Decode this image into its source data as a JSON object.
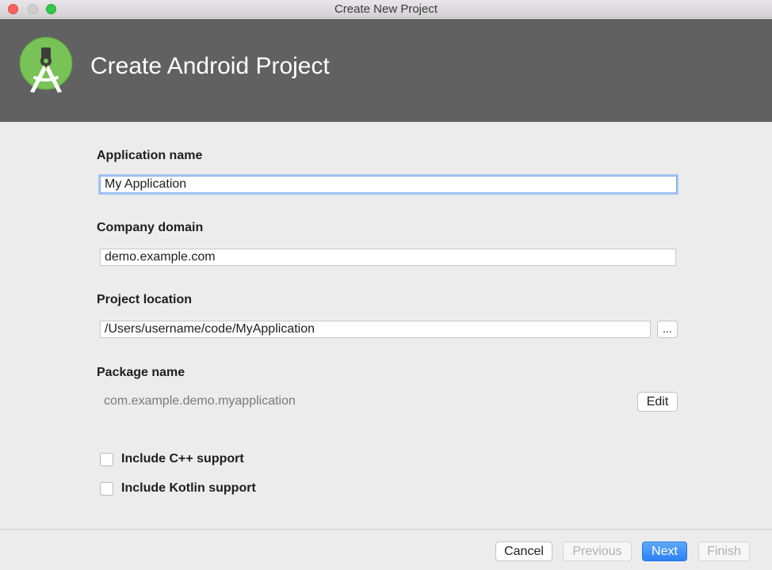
{
  "window": {
    "title": "Create New Project"
  },
  "header": {
    "title": "Create Android Project",
    "logo_icon": "android-studio-icon"
  },
  "form": {
    "application_name": {
      "label": "Application name",
      "value": "My Application"
    },
    "company_domain": {
      "label": "Company domain",
      "value": "demo.example.com"
    },
    "project_location": {
      "label": "Project location",
      "value": "/Users/username/code/MyApplication",
      "browse_label": "..."
    },
    "package_name": {
      "label": "Package name",
      "value": "com.example.demo.myapplication",
      "edit_label": "Edit"
    },
    "include_cpp": {
      "label": "Include C++ support",
      "checked": false
    },
    "include_kotlin": {
      "label": "Include Kotlin support",
      "checked": false
    }
  },
  "footer": {
    "cancel_label": "Cancel",
    "previous_label": "Previous",
    "next_label": "Next",
    "finish_label": "Finish"
  },
  "colors": {
    "header_bg": "#616161",
    "primary_button": "#2b81f3",
    "focus_ring": "#a9c8f3"
  }
}
